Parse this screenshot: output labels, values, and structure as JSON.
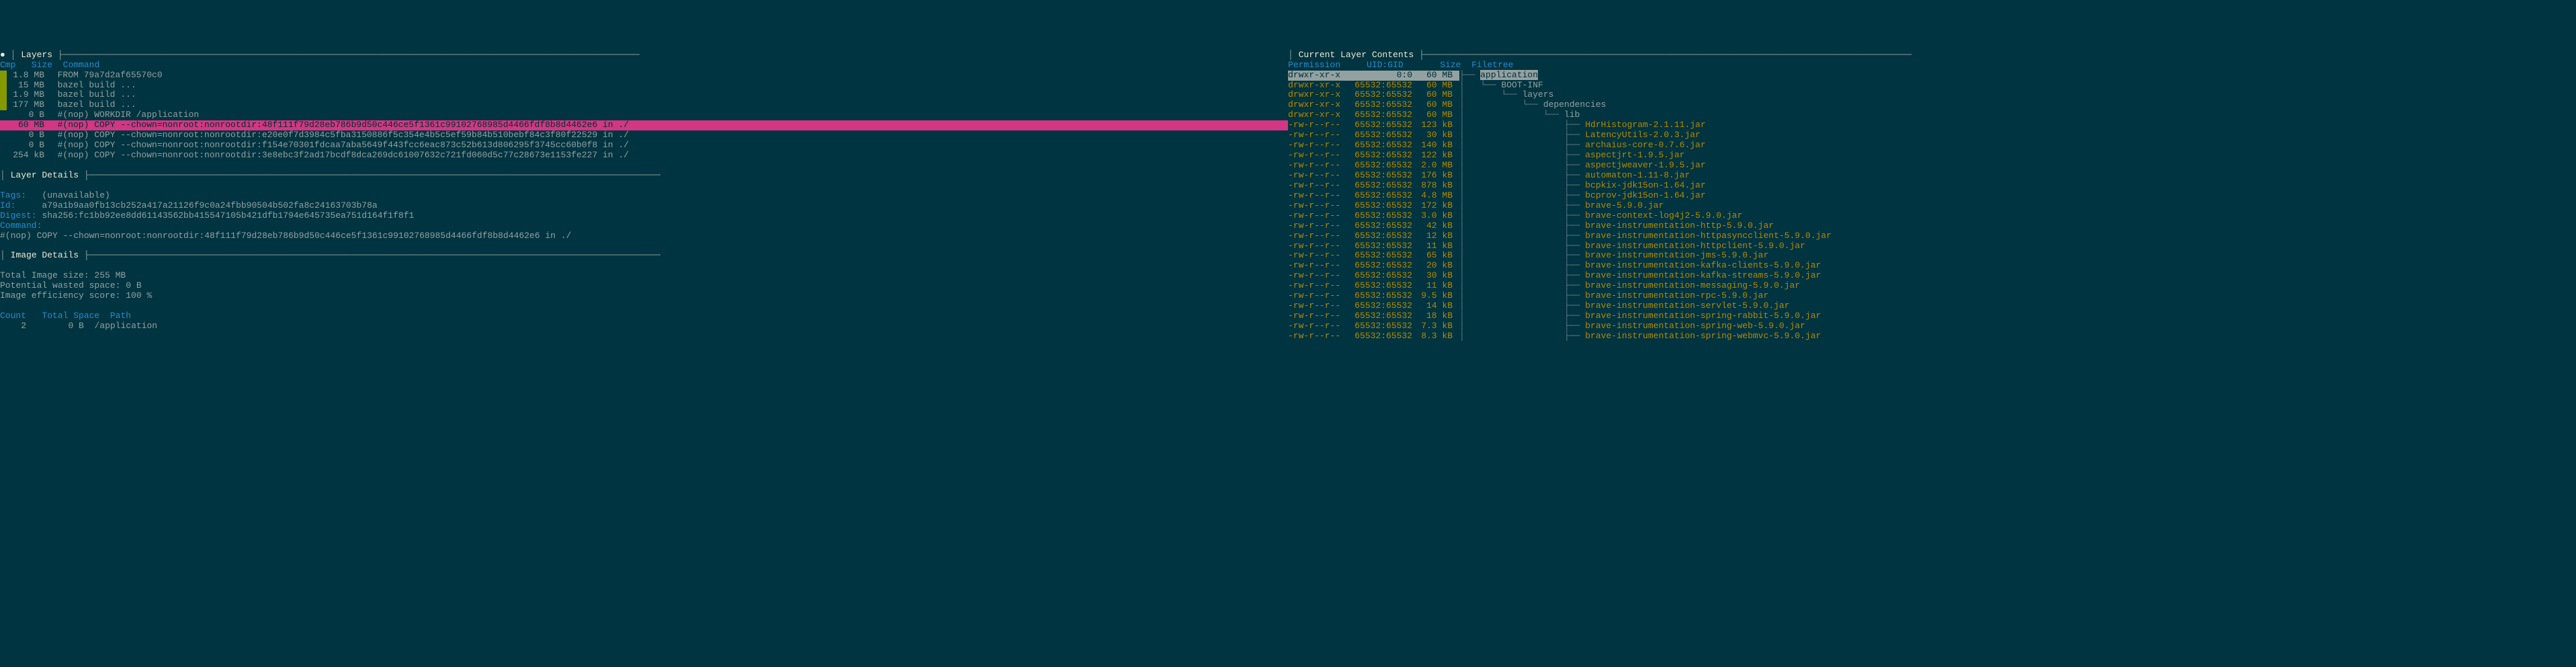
{
  "left": {
    "layers_header": "Layers",
    "col_cmp": "Cmp",
    "col_size": "Size",
    "col_command": "Command",
    "layers": [
      {
        "cmp": "green",
        "size": "1.8 MB",
        "cmd": "FROM 79a7d2af65570c0"
      },
      {
        "cmp": "green",
        "size": "15 MB",
        "cmd": "bazel build ..."
      },
      {
        "cmp": "green",
        "size": "1.9 MB",
        "cmd": "bazel build ..."
      },
      {
        "cmp": "green",
        "size": "177 MB",
        "cmd": "bazel build ..."
      },
      {
        "cmp": "",
        "size": "0 B",
        "cmd": "#(nop) WORKDIR /application"
      },
      {
        "cmp": "magenta",
        "size": "60 MB",
        "cmd": "#(nop) COPY --chown=nonroot:nonrootdir:48f111f79d28eb786b9d50c446ce5f1361c99102768985d4466fdf8b8d4462e6 in ./",
        "selected": true
      },
      {
        "cmp": "",
        "size": "0 B",
        "cmd": "#(nop) COPY --chown=nonroot:nonrootdir:e20e0f7d3984c5fba3150886f5c354e4b5c5ef59b84b510bebf84c3f80f22529 in ./"
      },
      {
        "cmp": "",
        "size": "0 B",
        "cmd": "#(nop) COPY --chown=nonroot:nonrootdir:f154e70301fdcaa7aba5649f443fcc6eac873c52b613d806295f3745cc60b0f8 in ./"
      },
      {
        "cmp": "",
        "size": "254 kB",
        "cmd": "#(nop) COPY --chown=nonroot:nonrootdir:3e8ebc3f2ad17bcdf8dca269dc61007632c721fd060d5c77c28673e1153fe227 in ./"
      }
    ],
    "layer_details_header": "Layer Details",
    "tags_label": "Tags:",
    "tags_value": "(unavailable)",
    "id_label": "Id:",
    "id_value": "a79a1b9aa0fb13cb252a417a21126f9c0a24fbb90504b502fa8c24163703b78a",
    "digest_label": "Digest:",
    "digest_value": "sha256:fc1bb92ee8dd61143562bb415547105b421dfb1794e645735ea751d164f1f8f1",
    "command_label": "Command:",
    "command_value": "#(nop) COPY --chown=nonroot:nonrootdir:48f111f79d28eb786b9d50c446ce5f1361c99102768985d4466fdf8b8d4462e6 in ./",
    "image_details_header": "Image Details",
    "total_size": "Total Image size: 255 MB",
    "wasted": "Potential wasted space: 0 B",
    "efficiency": "Image efficiency score: 100 %",
    "count_header": "Count",
    "total_space_header": "Total Space",
    "path_header": "Path",
    "dup_count": "2",
    "dup_size": "0 B",
    "dup_path": "/application"
  },
  "right": {
    "contents_header": "Current Layer Contents",
    "col_perm": "Permission",
    "col_uidgid": "UID:GID",
    "col_size": "Size",
    "col_tree": "Filetree",
    "files": [
      {
        "perm": "drwxr-xr-x",
        "uidgid": "0:0",
        "size": "60 MB",
        "tree": "├── ",
        "name": "application",
        "selected": true
      },
      {
        "perm": "drwxr-xr-x",
        "uidgid": "65532:65532",
        "size": "60 MB",
        "tree": "│   └── ",
        "name": "BOOT-INF",
        "dir": true
      },
      {
        "perm": "drwxr-xr-x",
        "uidgid": "65532:65532",
        "size": "60 MB",
        "tree": "│       └── ",
        "name": "layers",
        "dir": true
      },
      {
        "perm": "drwxr-xr-x",
        "uidgid": "65532:65532",
        "size": "60 MB",
        "tree": "│           └── ",
        "name": "dependencies",
        "dir": true
      },
      {
        "perm": "drwxr-xr-x",
        "uidgid": "65532:65532",
        "size": "60 MB",
        "tree": "│               └── ",
        "name": "lib",
        "dir": true
      },
      {
        "perm": "-rw-r--r--",
        "uidgid": "65532:65532",
        "size": "123 kB",
        "tree": "│                   ├── ",
        "name": "HdrHistogram-2.1.11.jar"
      },
      {
        "perm": "-rw-r--r--",
        "uidgid": "65532:65532",
        "size": "30 kB",
        "tree": "│                   ├── ",
        "name": "LatencyUtils-2.0.3.jar"
      },
      {
        "perm": "-rw-r--r--",
        "uidgid": "65532:65532",
        "size": "140 kB",
        "tree": "│                   ├── ",
        "name": "archaius-core-0.7.6.jar"
      },
      {
        "perm": "-rw-r--r--",
        "uidgid": "65532:65532",
        "size": "122 kB",
        "tree": "│                   ├── ",
        "name": "aspectjrt-1.9.5.jar"
      },
      {
        "perm": "-rw-r--r--",
        "uidgid": "65532:65532",
        "size": "2.0 MB",
        "tree": "│                   ├── ",
        "name": "aspectjweaver-1.9.5.jar"
      },
      {
        "perm": "-rw-r--r--",
        "uidgid": "65532:65532",
        "size": "176 kB",
        "tree": "│                   ├── ",
        "name": "automaton-1.11-8.jar"
      },
      {
        "perm": "-rw-r--r--",
        "uidgid": "65532:65532",
        "size": "878 kB",
        "tree": "│                   ├── ",
        "name": "bcpkix-jdk15on-1.64.jar"
      },
      {
        "perm": "-rw-r--r--",
        "uidgid": "65532:65532",
        "size": "4.8 MB",
        "tree": "│                   ├── ",
        "name": "bcprov-jdk15on-1.64.jar"
      },
      {
        "perm": "-rw-r--r--",
        "uidgid": "65532:65532",
        "size": "172 kB",
        "tree": "│                   ├── ",
        "name": "brave-5.9.0.jar"
      },
      {
        "perm": "-rw-r--r--",
        "uidgid": "65532:65532",
        "size": "3.0 kB",
        "tree": "│                   ├── ",
        "name": "brave-context-log4j2-5.9.0.jar"
      },
      {
        "perm": "-rw-r--r--",
        "uidgid": "65532:65532",
        "size": "42 kB",
        "tree": "│                   ├── ",
        "name": "brave-instrumentation-http-5.9.0.jar"
      },
      {
        "perm": "-rw-r--r--",
        "uidgid": "65532:65532",
        "size": "12 kB",
        "tree": "│                   ├── ",
        "name": "brave-instrumentation-httpasyncclient-5.9.0.jar"
      },
      {
        "perm": "-rw-r--r--",
        "uidgid": "65532:65532",
        "size": "11 kB",
        "tree": "│                   ├── ",
        "name": "brave-instrumentation-httpclient-5.9.0.jar"
      },
      {
        "perm": "-rw-r--r--",
        "uidgid": "65532:65532",
        "size": "65 kB",
        "tree": "│                   ├── ",
        "name": "brave-instrumentation-jms-5.9.0.jar"
      },
      {
        "perm": "-rw-r--r--",
        "uidgid": "65532:65532",
        "size": "20 kB",
        "tree": "│                   ├── ",
        "name": "brave-instrumentation-kafka-clients-5.9.0.jar"
      },
      {
        "perm": "-rw-r--r--",
        "uidgid": "65532:65532",
        "size": "30 kB",
        "tree": "│                   ├── ",
        "name": "brave-instrumentation-kafka-streams-5.9.0.jar"
      },
      {
        "perm": "-rw-r--r--",
        "uidgid": "65532:65532",
        "size": "11 kB",
        "tree": "│                   ├── ",
        "name": "brave-instrumentation-messaging-5.9.0.jar"
      },
      {
        "perm": "-rw-r--r--",
        "uidgid": "65532:65532",
        "size": "9.5 kB",
        "tree": "│                   ├── ",
        "name": "brave-instrumentation-rpc-5.9.0.jar"
      },
      {
        "perm": "-rw-r--r--",
        "uidgid": "65532:65532",
        "size": "14 kB",
        "tree": "│                   ├── ",
        "name": "brave-instrumentation-servlet-5.9.0.jar"
      },
      {
        "perm": "-rw-r--r--",
        "uidgid": "65532:65532",
        "size": "18 kB",
        "tree": "│                   ├── ",
        "name": "brave-instrumentation-spring-rabbit-5.9.0.jar"
      },
      {
        "perm": "-rw-r--r--",
        "uidgid": "65532:65532",
        "size": "7.3 kB",
        "tree": "│                   ├── ",
        "name": "brave-instrumentation-spring-web-5.9.0.jar"
      },
      {
        "perm": "-rw-r--r--",
        "uidgid": "65532:65532",
        "size": "8.3 kB",
        "tree": "│                   ├── ",
        "name": "brave-instrumentation-spring-webmvc-5.9.0.jar"
      }
    ]
  }
}
